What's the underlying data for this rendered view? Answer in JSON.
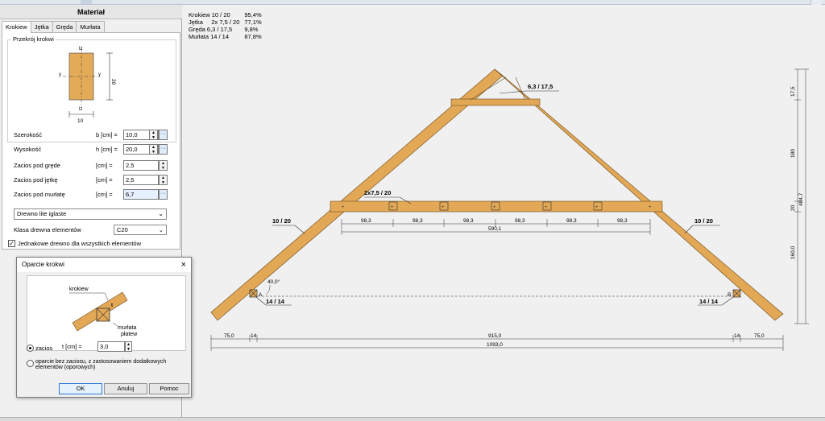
{
  "window": {
    "close_symbol": "×"
  },
  "panel": {
    "title": "Materiał",
    "tabs": [
      "Krokiew",
      "Jętka",
      "Gręda",
      "Murłata"
    ],
    "section_title": "Przekrój krokwi",
    "section_dims": {
      "axis_z": "lz",
      "axis_y": "y",
      "width": "10",
      "height": "20"
    },
    "fields": [
      {
        "label": "Szerokość",
        "unit": "b [cm] =",
        "value": "10,0",
        "control": "spin-more"
      },
      {
        "label": "Wysokość",
        "unit": "h [cm] =",
        "value": "20,0",
        "control": "spin-more"
      },
      {
        "label": "Zacios pod gręde",
        "unit": "[cm] =",
        "value": "2,5",
        "control": "spin"
      },
      {
        "label": "Zacios pod jętkę",
        "unit": "[cm] =",
        "value": "2,5",
        "control": "spin"
      },
      {
        "label": "Zacios pod murłatę",
        "unit": "[cm] =",
        "value": "6,7",
        "control": "more"
      }
    ],
    "material_select": "Drewno lite iglaste",
    "class_label": "Klasa drewna elementów",
    "class_value": "C20",
    "same_wood_label": "Jednakowe drewno dla wszystkich elementów",
    "same_wood_checked": true
  },
  "dialog": {
    "title": "Oparcie krokwi",
    "img_labels": {
      "rafter": "krokiew",
      "plate": "murłata",
      "plate2": "płatew",
      "t": "t"
    },
    "radio1_label": "zacios",
    "t_label": "t [cm] =",
    "t_value": "3,0",
    "radio2_label": "oparcie bez zaciosu, z zastosowaniem dodatkowych elementów (oporowych)",
    "ok": "OK",
    "cancel": "Anuluj",
    "help": "Pomoc"
  },
  "stats": [
    {
      "name": "Krokiew 10 / 20",
      "value": "95,4%"
    },
    {
      "name": "Jętka     2x 7,5 / 20",
      "value": "77,1%"
    },
    {
      "name": "Gręda 6,3 / 17,5",
      "value": "9,8%"
    },
    {
      "name": "Murłata 14 / 14",
      "value": "87,8%"
    }
  ],
  "drawing": {
    "labels": {
      "greda": "6,3 / 17,5",
      "jetka": "2x7,5 / 20",
      "krokiew_left": "10 / 20",
      "krokiew_right": "10 / 20",
      "murlata_left": "14 / 14",
      "murlata_right": "14 / 14",
      "angle": "40,0°",
      "pointA": "A",
      "pointB": "B"
    },
    "spans_jetka": [
      "98,3",
      "98,3",
      "98,3",
      "98,3",
      "98,3",
      "98,3"
    ],
    "span_jetka_total": "590,1",
    "bottom_dims": [
      "75,0",
      "14",
      "915,0",
      "14",
      "75,0"
    ],
    "bottom_total": "1093,0",
    "right_dims": [
      "17,5",
      "180",
      "20",
      "160,0"
    ],
    "right_total": "484,7"
  }
}
